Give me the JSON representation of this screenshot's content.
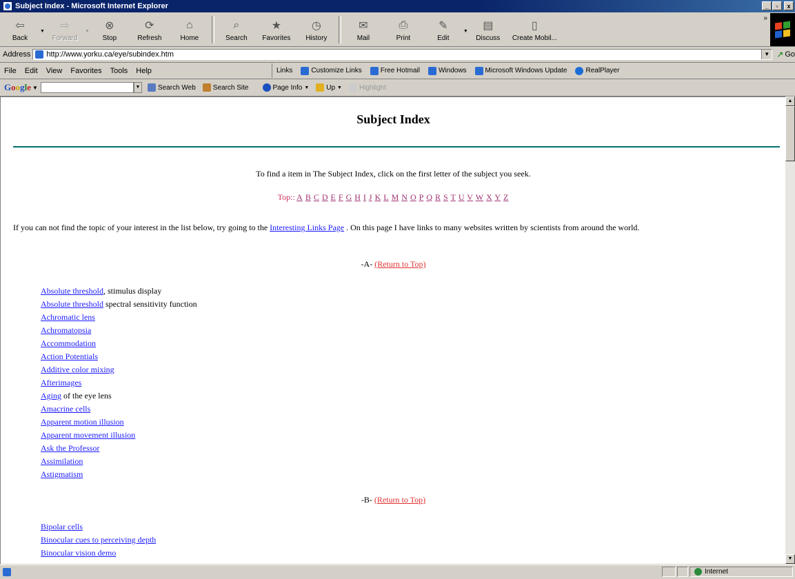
{
  "window": {
    "title": "Subject Index - Microsoft Internet Explorer",
    "controls": [
      "_",
      "▫",
      "x"
    ]
  },
  "toolbar": {
    "buttons": [
      {
        "label": "Back",
        "icon": "back-arrow-icon"
      },
      {
        "label": "Forward",
        "icon": "forward-arrow-icon"
      },
      {
        "label": "Stop",
        "icon": "stop-icon"
      },
      {
        "label": "Refresh",
        "icon": "refresh-icon"
      },
      {
        "label": "Home",
        "icon": "home-icon"
      },
      {
        "label": "Search",
        "icon": "search-icon"
      },
      {
        "label": "Favorites",
        "icon": "favorites-icon"
      },
      {
        "label": "History",
        "icon": "history-icon"
      },
      {
        "label": "Mail",
        "icon": "mail-icon"
      },
      {
        "label": "Print",
        "icon": "print-icon"
      },
      {
        "label": "Edit",
        "icon": "edit-icon"
      },
      {
        "label": "Discuss",
        "icon": "discuss-icon"
      },
      {
        "label": "Create Mobil...",
        "icon": "create-mobile-icon"
      }
    ],
    "overflow": "»"
  },
  "address": {
    "label": "Address",
    "url": "http://www.yorku.ca/eye/subindex.htm",
    "go_label": "Go"
  },
  "menu": [
    "File",
    "Edit",
    "View",
    "Favorites",
    "Tools",
    "Help"
  ],
  "links": {
    "label": "Links",
    "items": [
      "Customize Links",
      "Free Hotmail",
      "Windows",
      "Microsoft Windows Update",
      "RealPlayer"
    ]
  },
  "google": {
    "logo": [
      "G",
      "o",
      "o",
      "g",
      "l",
      "e"
    ],
    "search_web": "Search Web",
    "search_site": "Search Site",
    "page_info": "Page Info",
    "up": "Up",
    "highlight": "Highlight"
  },
  "page": {
    "title": "Subject Index",
    "intro": "To find a item in The Subject Index, click on the first letter of the subject you seek.",
    "top_label": "Top::",
    "letters": [
      "A",
      "B",
      "C",
      "D",
      "E",
      "F",
      "G",
      "H",
      "I",
      "J",
      "K",
      "L",
      "M",
      "N",
      "O",
      "P",
      "Q",
      "R",
      "S",
      "T",
      "U",
      "V",
      "W",
      "X",
      "Y",
      "Z"
    ],
    "note_before": "If you can not find the topic of your interest in the list below, try going to the ",
    "note_link": "Interesting Links Page",
    "note_after": " .   On this page I have links to many websites written by scientists from around the world.",
    "return_label": "(Return to Top)",
    "section_a": "-A-",
    "section_b": "-B-",
    "a_items": [
      {
        "link": "Absolute threshold",
        "suffix": ", stimulus display"
      },
      {
        "link": "Absolute threshold",
        "suffix": " spectral sensitivity function"
      },
      {
        "link": "Achromatic lens",
        "suffix": ""
      },
      {
        "link": "Achromatopsia",
        "suffix": ""
      },
      {
        "link": "Accommodation",
        "suffix": ""
      },
      {
        "link": "Action Potentials",
        "suffix": ""
      },
      {
        "link": "Additive color mixing",
        "suffix": ""
      },
      {
        "link": "Afterimages",
        "suffix": ""
      },
      {
        "link": "Aging",
        "suffix": " of the eye lens"
      },
      {
        "link": "Amacrine cells",
        "suffix": ""
      },
      {
        "link": "Apparent motion illusion",
        "suffix": ""
      },
      {
        "link": "Apparent movement illusion",
        "suffix": ""
      },
      {
        "link": "Ask the Professor",
        "suffix": ""
      },
      {
        "link": "Assimilation",
        "suffix": ""
      },
      {
        "link": "Astigmatism",
        "suffix": ""
      }
    ],
    "b_items": [
      {
        "link": "Bipolar cells",
        "suffix": ""
      },
      {
        "link": "Binocular cues to perceiving depth",
        "suffix": ""
      },
      {
        "link": "Binocular vision demo",
        "suffix": ""
      }
    ]
  },
  "status": {
    "zone": "Internet"
  },
  "colors": {
    "titlebar": "#0a246a",
    "link": "#1a1aff",
    "rule": "#007070",
    "return_link": "#e03030"
  }
}
